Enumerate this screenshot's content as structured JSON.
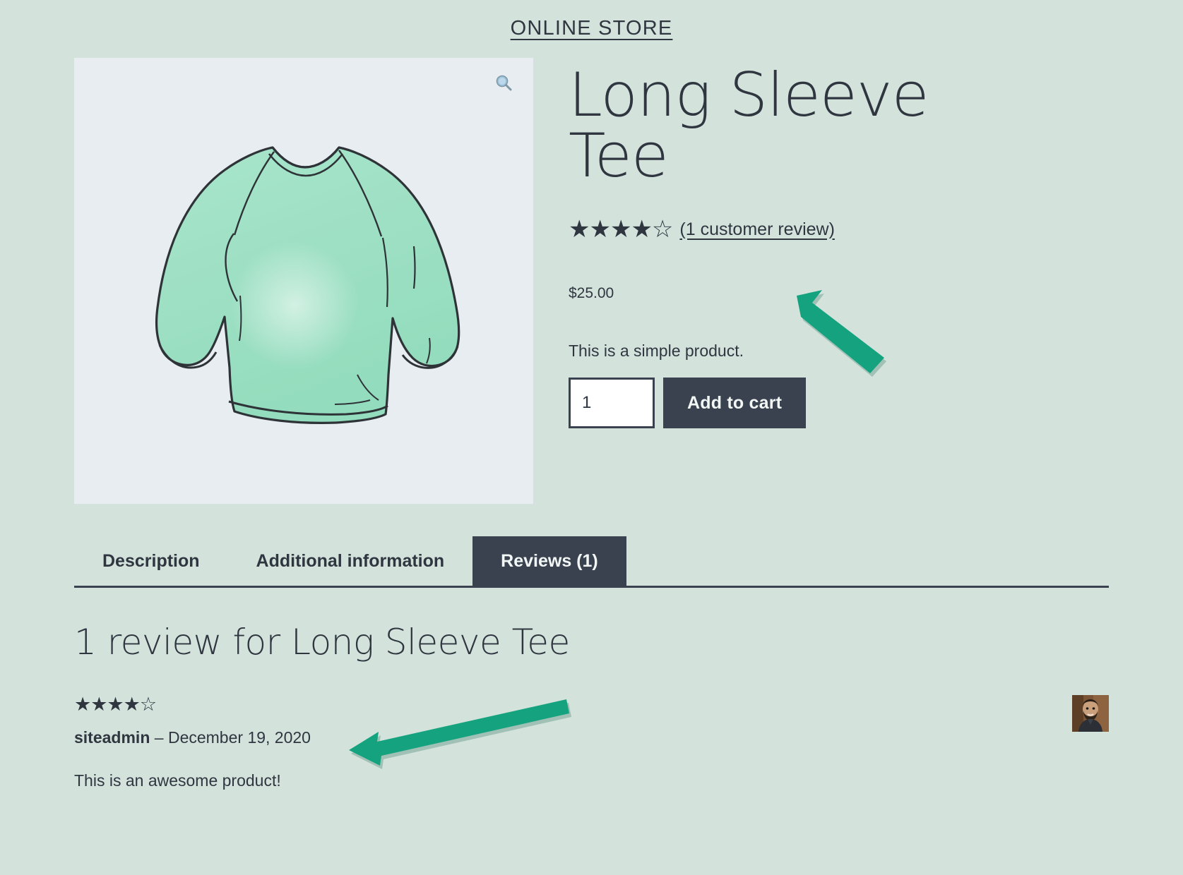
{
  "site": {
    "title": "ONLINE STORE"
  },
  "product": {
    "title": "Long Sleeve Tee",
    "price": "$25.00",
    "short_description": "This is a simple product.",
    "rating_stars": "★★★★☆",
    "rating_value": 4,
    "rating_max": 5,
    "review_link": "(1 customer review)",
    "quantity_value": "1",
    "quantity_placeholder": "1",
    "add_to_cart_label": "Add to cart",
    "gallery": {
      "zoom_icon": "magnifier-icon",
      "image_alt": "Long Sleeve Tee illustration",
      "background_color": "#e8edf1",
      "shirt_color": "#9fe0c4"
    }
  },
  "tabs": [
    {
      "label": "Description",
      "active": false
    },
    {
      "label": "Additional information",
      "active": false
    },
    {
      "label": "Reviews (1)",
      "active": true
    }
  ],
  "reviews_section": {
    "heading": "1 review for Long Sleeve Tee",
    "items": [
      {
        "stars": "★★★★☆",
        "rating": 4,
        "author": "siteadmin",
        "separator": " – ",
        "date": "December 19, 2020",
        "text": "This is an awesome product!",
        "avatar": "user-avatar"
      }
    ]
  },
  "annotations": {
    "color": "#15a37f",
    "arrows": [
      {
        "name": "arrow-pointing-to-customer-review-link"
      },
      {
        "name": "arrow-pointing-to-review-author-date"
      }
    ]
  },
  "colors": {
    "page_background": "#d3e3dc",
    "dark": "#3a4250",
    "text": "#2f3640",
    "accent_green": "#15a37f"
  }
}
